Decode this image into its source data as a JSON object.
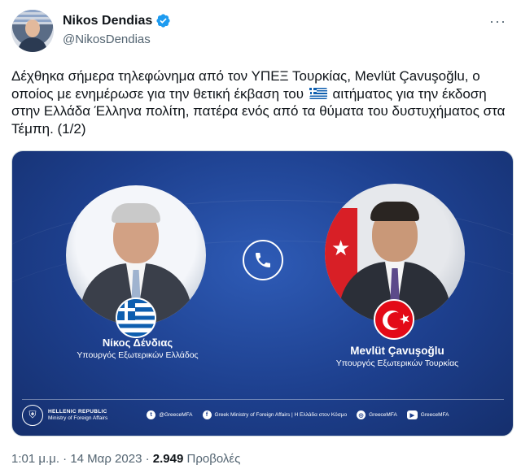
{
  "author": {
    "display_name": "Nikos Dendias",
    "handle": "@NikosDendias",
    "verified": true
  },
  "tweet": {
    "text_part1": "Δέχθηκα σήμερα τηλεφώνημα από τον ΥΠΕΞ Τουρκίας, Mevlüt Çavuşoğlu, ο οποίος με ενημέρωσε για την θετική έκβαση του",
    "flag_emoji": "greece-flag",
    "text_part2": "αιτήματος για την έκδοση στην Ελλάδα Έλληνα πολίτη, πατέρα ενός από τα θύματα του δυστυχήματος στα Τέμπη. (1/2)"
  },
  "media": {
    "left_person": {
      "name": "Νίκος Δένδιας",
      "role": "Υπουργός Εξωτερικών Ελλάδος"
    },
    "right_person": {
      "name": "Mevlüt Çavuşoğlu",
      "role": "Υπουργός Εξωτερικών Τουρκίας"
    },
    "center_icon": "phone-icon",
    "footer": {
      "org_line1": "HELLENIC REPUBLIC",
      "org_line2": "Ministry of Foreign Affairs",
      "twitter": "@GreeceMFA",
      "facebook": "Greek Ministry of Foreign Affairs | Η Ελλάδα στον Κόσμο",
      "instagram": "GreeceMFA",
      "youtube": "GreeceMFA"
    },
    "background_color": "#1d3f8d"
  },
  "meta": {
    "time": "1:01 μ.μ.",
    "separator": "·",
    "date": "14 Μαρ 2023",
    "views_count": "2.949",
    "views_label": "Προβολές"
  },
  "colors": {
    "verified": "#1d9bf0",
    "secondary_text": "#536471"
  }
}
